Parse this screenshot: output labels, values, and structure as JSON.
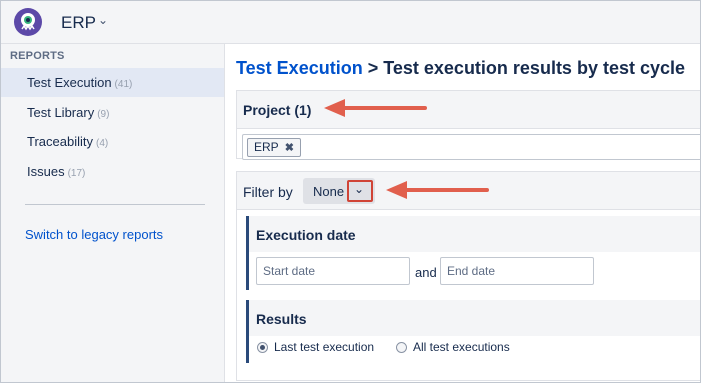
{
  "app": {
    "name": "ERP",
    "logo_icon": "monster-logo-icon",
    "accent": "#0052cc"
  },
  "sidebar": {
    "heading": "REPORTS",
    "items": [
      {
        "label": "Test Execution",
        "count": "(41)",
        "active": true
      },
      {
        "label": "Test Library",
        "count": "(9)",
        "active": false
      },
      {
        "label": "Traceability",
        "count": "(4)",
        "active": false
      },
      {
        "label": "Issues",
        "count": "(17)",
        "active": false
      }
    ],
    "legacy_link": "Switch to legacy reports"
  },
  "main": {
    "breadcrumb_link": "Test Execution",
    "breadcrumb_separator": " > ",
    "title": "Test execution results by test cycle",
    "project": {
      "title": "Project (1)",
      "selected_tag": "ERP",
      "tag_remove_icon": "close-icon"
    },
    "filter": {
      "label": "Filter by",
      "selected": "None",
      "dropdown_icon": "chevron-down-icon",
      "execution_date": {
        "title": "Execution date",
        "start_placeholder": "Start date",
        "and_text": "and",
        "end_placeholder": "End date"
      },
      "results": {
        "title": "Results",
        "options": [
          {
            "label": "Last test execution",
            "checked": true
          },
          {
            "label": "All test executions",
            "checked": false
          }
        ]
      }
    }
  },
  "annotations": {
    "arrow_color": "#e15f4d"
  }
}
